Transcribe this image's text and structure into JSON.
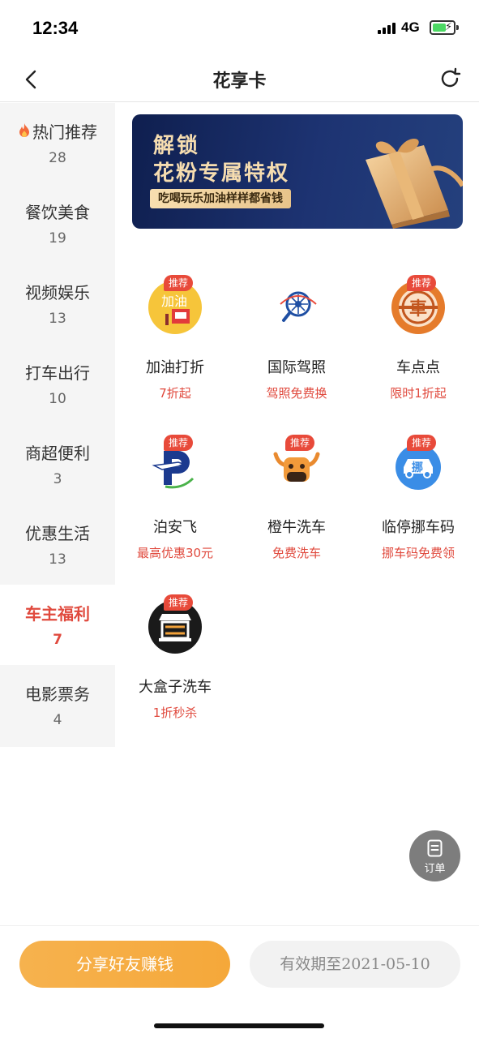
{
  "status": {
    "time": "12:34",
    "network": "4G"
  },
  "nav": {
    "title": "花享卡"
  },
  "sidebar": {
    "items": [
      {
        "label": "热门推荐",
        "count": "28"
      },
      {
        "label": "餐饮美食",
        "count": "19"
      },
      {
        "label": "视频娱乐",
        "count": "13"
      },
      {
        "label": "打车出行",
        "count": "10"
      },
      {
        "label": "商超便利",
        "count": "3"
      },
      {
        "label": "优惠生活",
        "count": "13"
      },
      {
        "label": "车主福利",
        "count": "7"
      },
      {
        "label": "电影票务",
        "count": "4"
      }
    ],
    "active_index": 6
  },
  "banner": {
    "line1": "解锁",
    "line2": "花粉专属特权",
    "tagline": "吃喝玩乐加油样样都省钱"
  },
  "grid": {
    "badge": "推荐",
    "items": [
      {
        "name": "加油打折",
        "desc": "7折起",
        "icon": "fuel-icon",
        "recommended": true
      },
      {
        "name": "国际驾照",
        "desc": "驾照免费换",
        "icon": "license-icon",
        "recommended": false
      },
      {
        "name": "车点点",
        "desc": "限时1折起",
        "icon": "car-char-icon",
        "recommended": true
      },
      {
        "name": "泊安飞",
        "desc": "最高优惠30元",
        "icon": "parking-plane-icon",
        "recommended": true
      },
      {
        "name": "橙牛洗车",
        "desc": "免费洗车",
        "icon": "bull-icon",
        "recommended": true
      },
      {
        "name": "临停挪车码",
        "desc": "挪车码免费领",
        "icon": "move-car-icon",
        "recommended": true
      },
      {
        "name": "大盒子洗车",
        "desc": "1折秒杀",
        "icon": "box-wash-icon",
        "recommended": true
      }
    ]
  },
  "float": {
    "label": "订单"
  },
  "bottom": {
    "share_label": "分享好友赚钱",
    "validity_label": "有效期至2021-05-10"
  },
  "icon_texts": {
    "fuel": "加油",
    "car_char": "車",
    "move": "挪"
  },
  "colors": {
    "accent_red": "#e04a3e",
    "badge_red": "#e84a3a",
    "share_orange": "#f5a83a",
    "banner_navy": "#13265c"
  }
}
